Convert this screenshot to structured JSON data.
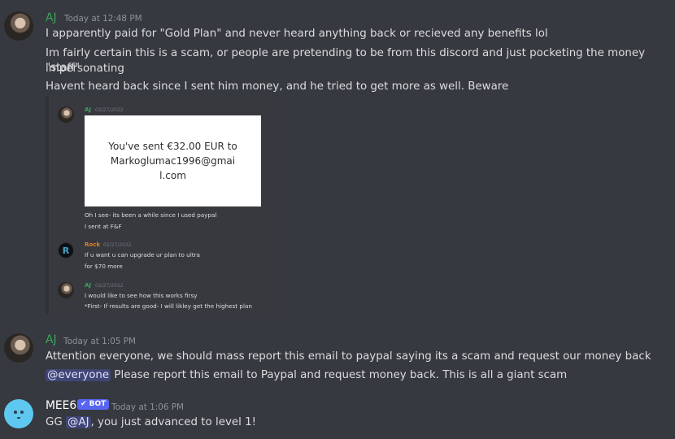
{
  "messages": [
    {
      "author": "AJ",
      "timestamp": "Today at 12:48 PM",
      "lines": [
        "I apparently paid for \"Gold Plan\" and never heard anything back or recieved any benefits lol",
        "Im fairly certain this is a scam, or people are pretending to be from this discord and just pocketing the money impersonating",
        "\"staff\"",
        "Havent heard back since I sent him money, and he tried to get more as well. Beware"
      ]
    },
    {
      "author": "AJ",
      "timestamp": "Today at 1:05 PM",
      "line1": "Attention everyone, we should mass report this email to paypal saying its a scam and request our money back",
      "mention": "@everyone",
      "line2": "Please report this email to Paypal and request money back. This is all a giant scam"
    },
    {
      "author": "MEE6",
      "bot_tag": "✔ BOT",
      "timestamp": "Today at 1:06 PM",
      "prefix": "GG",
      "mention": "@AJ",
      "suffix": ", you just advanced to level 1!"
    }
  ],
  "embed": {
    "msg1": {
      "author": "AJ",
      "date": "02/27/2022",
      "paypal_text": "You've sent €32.00 EUR to Markoglumac1996@gmail.com",
      "line1": "Oh I see- its been a while since I used paypal",
      "line2": "I sent at F&F"
    },
    "msg2": {
      "author": "Rock",
      "date": "02/27/2022",
      "avatar_letter": "R",
      "line1": "If u want u can upgrade ur plan to ultra",
      "line2": "for $70 more"
    },
    "msg3": {
      "author": "AJ",
      "date": "02/27/2022",
      "line1": "I would like to see how this works firsy",
      "line2": "*First- If results are good- I will likley get the highest plan"
    }
  }
}
